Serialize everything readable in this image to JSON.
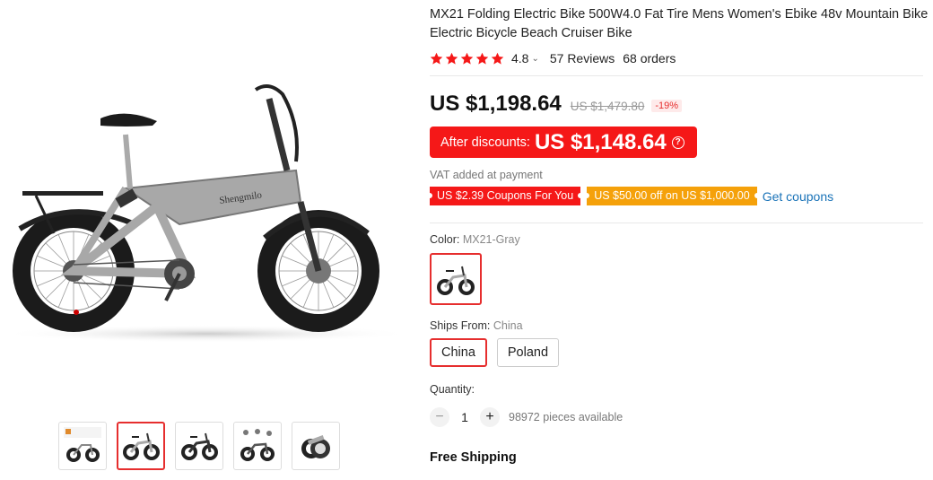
{
  "product": {
    "title": "MX21 Folding Electric Bike 500W4.0 Fat Tire Mens Women's Ebike 48v Mountain Bike Electric Bicycle Beach Cruiser Bike",
    "rating": "4.8",
    "reviews": "57 Reviews",
    "orders": "68 orders",
    "stars": 5
  },
  "pricing": {
    "price": "US $1,198.64",
    "original_price": "US $1,479.80",
    "discount": "-19%",
    "after_label": "After discounts:",
    "after_price": "US $1,148.64",
    "vat": "VAT added at payment"
  },
  "coupons": {
    "items": [
      "US $2.39 Coupons For You",
      "US $50.00 off on US $1,000.00"
    ],
    "get_label": "Get coupons"
  },
  "color": {
    "label": "Color:",
    "value": "MX21-Gray"
  },
  "ships_from": {
    "label": "Ships From:",
    "value": "China",
    "options": [
      "China",
      "Poland"
    ]
  },
  "quantity": {
    "label": "Quantity:",
    "value": "1",
    "minus": "−",
    "plus": "+",
    "available": "98972 pieces available"
  },
  "shipping": {
    "label": "Free Shipping"
  },
  "colors": {
    "accent_red": "#f51818",
    "coupon_orange": "#f5a10a",
    "link_blue": "#1a73b8",
    "star": "#f51818"
  }
}
